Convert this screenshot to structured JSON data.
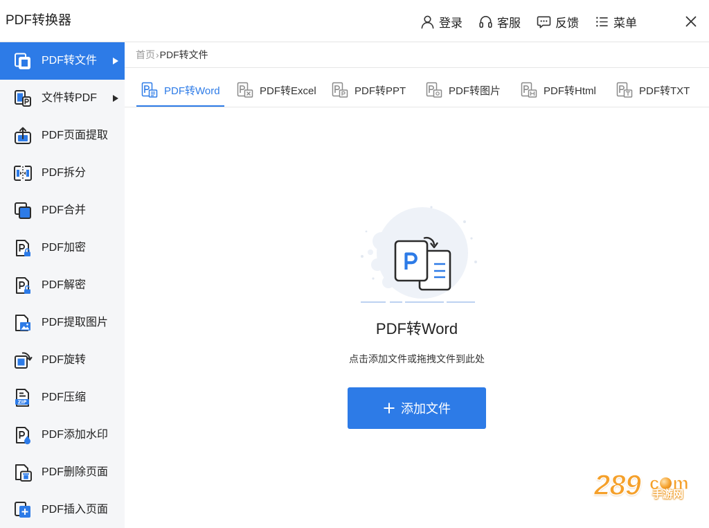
{
  "window": {
    "title": "PDF转换器"
  },
  "header": {
    "actions": [
      {
        "label": "登录",
        "icon": "user-icon"
      },
      {
        "label": "客服",
        "icon": "headset-icon"
      },
      {
        "label": "反馈",
        "icon": "chat-icon"
      },
      {
        "label": "菜单",
        "icon": "menu-icon"
      }
    ],
    "close_icon": "close-icon"
  },
  "sidebar": {
    "items": [
      {
        "label": "PDF转文件",
        "icon": "convert-to-file-icon",
        "has_submenu": true,
        "active": true
      },
      {
        "label": "文件转PDF",
        "icon": "file-to-pdf-icon",
        "has_submenu": true,
        "active": false
      },
      {
        "label": "PDF页面提取",
        "icon": "extract-page-icon",
        "active": false
      },
      {
        "label": "PDF拆分",
        "icon": "split-icon",
        "active": false
      },
      {
        "label": "PDF合并",
        "icon": "merge-icon",
        "active": false
      },
      {
        "label": "PDF加密",
        "icon": "lock-icon",
        "active": false
      },
      {
        "label": "PDF解密",
        "icon": "unlock-icon",
        "active": false
      },
      {
        "label": "PDF提取图片",
        "icon": "extract-image-icon",
        "active": false
      },
      {
        "label": "PDF旋转",
        "icon": "rotate-icon",
        "active": false
      },
      {
        "label": "PDF压缩",
        "icon": "zip-icon",
        "active": false
      },
      {
        "label": "PDF添加水印",
        "icon": "watermark-drop-icon",
        "active": false
      },
      {
        "label": "PDF删除页面",
        "icon": "delete-page-icon",
        "active": false
      },
      {
        "label": "PDF插入页面",
        "icon": "insert-page-icon",
        "active": false
      }
    ]
  },
  "breadcrumb": {
    "home": "首页",
    "separator": "›",
    "current": "PDF转文件"
  },
  "tabs": [
    {
      "label": "PDF转Word",
      "icon": "pdf-word-icon",
      "active": true
    },
    {
      "label": "PDF转Excel",
      "icon": "pdf-excel-icon",
      "active": false
    },
    {
      "label": "PDF转PPT",
      "icon": "pdf-ppt-icon",
      "active": false
    },
    {
      "label": "PDF转图片",
      "icon": "pdf-image-icon",
      "active": false
    },
    {
      "label": "PDF转Html",
      "icon": "pdf-html-icon",
      "active": false
    },
    {
      "label": "PDF转TXT",
      "icon": "pdf-txt-icon",
      "active": false
    }
  ],
  "dropzone": {
    "illustration": "pdf-to-word-illustration",
    "title": "PDF转Word",
    "hint": "点击添加文件或拖拽文件到此处",
    "button_label": "添加文件",
    "button_icon": "plus-icon"
  },
  "icon_badges": {
    "compress": "ZIP"
  },
  "watermark": {
    "digits": "289",
    "letter_c": "c",
    "letter_m": "m",
    "tagline": "手游网"
  },
  "colors": {
    "accent": "#2d7be7",
    "sidebar_background": "#f5f6f8",
    "text": "#222222",
    "muted_text": "#999999",
    "watermark_orange": "#f5a02a"
  }
}
